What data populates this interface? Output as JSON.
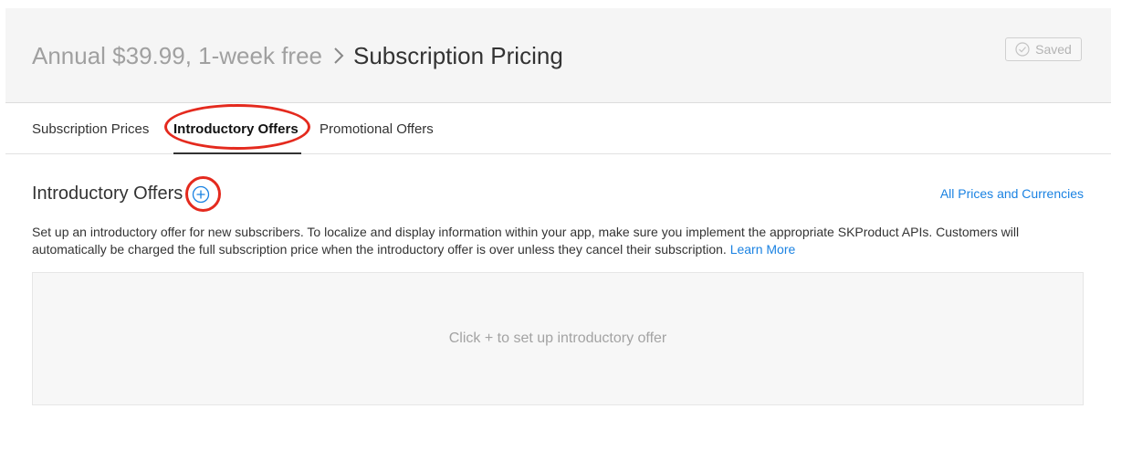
{
  "header": {
    "parent_crumb": "Annual $39.99, 1-week free",
    "current_crumb": "Subscription Pricing",
    "saved_label": "Saved"
  },
  "tabs": [
    {
      "label": "Subscription Prices",
      "active": false
    },
    {
      "label": "Introductory Offers",
      "active": true
    },
    {
      "label": "Promotional Offers",
      "active": false
    }
  ],
  "section": {
    "title": "Introductory Offers",
    "all_prices_link": "All Prices and Currencies",
    "description": "Set up an introductory offer for new subscribers. To localize and display information within your app, make sure you implement the appropriate SKProduct APIs. Customers will automatically be charged the full subscription price when the introductory offer is over unless they cancel their subscription.",
    "learn_more": "Learn More",
    "empty_state": "Click + to set up introductory offer"
  },
  "icons": {
    "breadcrumb_separator": "chevron-right-icon",
    "saved": "check-circle-icon",
    "add": "plus-circle-icon"
  },
  "colors": {
    "accent": "#1a82e2",
    "annotation": "#e42a1e",
    "header_bg": "#f5f5f5"
  }
}
